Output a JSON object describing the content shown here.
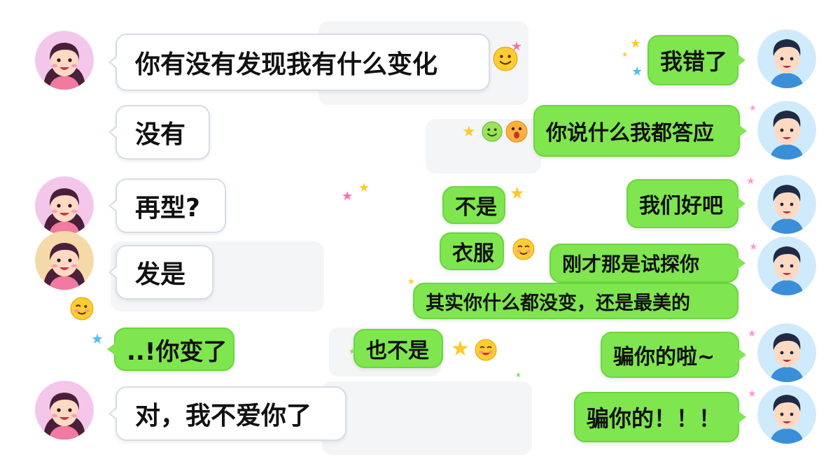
{
  "colors": {
    "green_bubble": "#7fe64f",
    "white_bubble_border": "#d6dde6",
    "girl_avatar_bg": "#f3c6ea",
    "boy_avatar_bg": "#cfeafb"
  },
  "messages": {
    "g1": "你有没有发现我有什么变化",
    "g2": "没有",
    "g3": "再型?",
    "g4": "发是",
    "g5": "..!你变了",
    "g6": "对，我不爱你了",
    "b1": "我错了",
    "b2": "你说什么我都答应",
    "b3": "我们好吧",
    "b4a": "刚才那是试探你",
    "b4b": "其实你什么都没变，还是最美的",
    "b5": "骗你的啦~",
    "b6": "骗你的！！！",
    "m1": "不是",
    "m2": "衣服",
    "m3": "也不是"
  },
  "icons": {
    "girl_avatar": "girl-avatar",
    "boy_avatar": "boy-avatar",
    "smile_emoji": "smiling-face-emoji",
    "shocked_emoji": "shocked-face-emoji",
    "blush_emoji": "blushing-face-emoji",
    "star": "star-sparkle"
  }
}
